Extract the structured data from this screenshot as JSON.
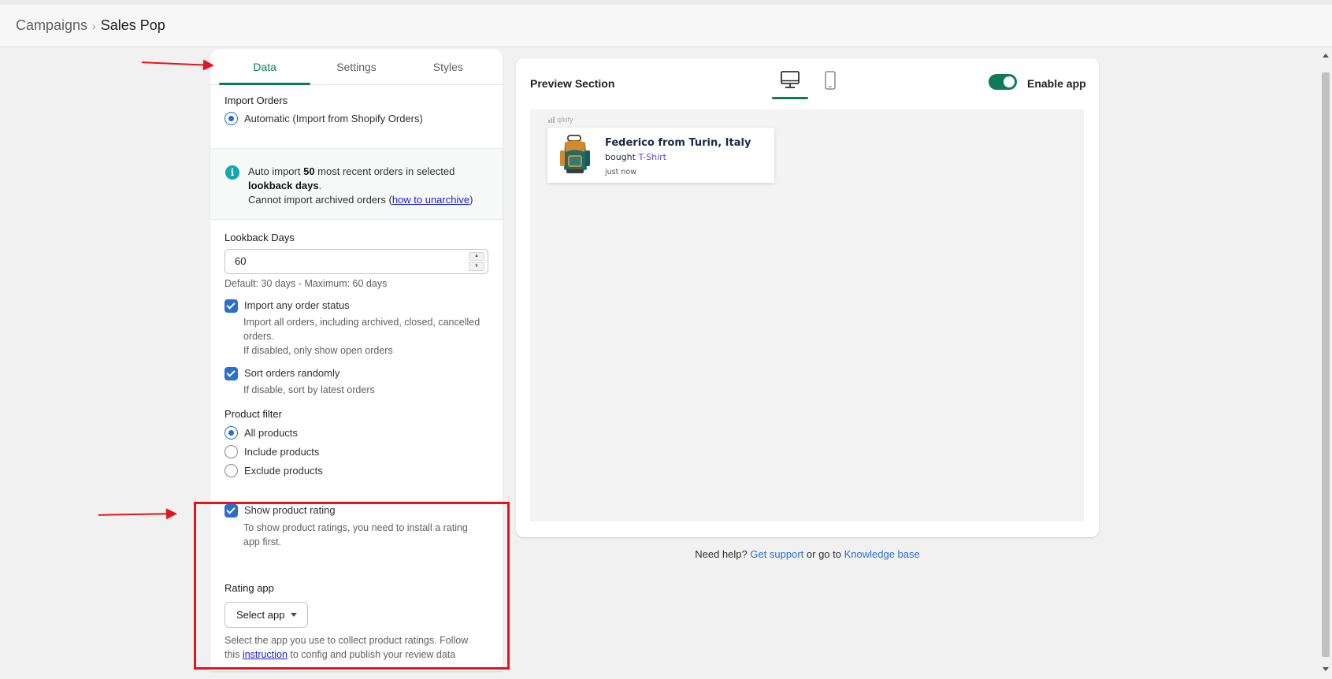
{
  "breadcrumb": {
    "parent": "Campaigns",
    "separator": "›",
    "current": "Sales Pop"
  },
  "tabs": [
    {
      "label": "Data",
      "active": true
    },
    {
      "label": "Settings",
      "active": false
    },
    {
      "label": "Styles",
      "active": false
    }
  ],
  "import_orders": {
    "label": "Import Orders",
    "option": "Automatic (Import from Shopify Orders)"
  },
  "info": {
    "line1_pre": "Auto import ",
    "count": "50",
    "line1_post": " most recent orders in selected",
    "line2_bold": "lookback days",
    "line2_post": ".",
    "line3_pre": "Cannot import archived orders (",
    "line3_link": "how to unarchive",
    "line3_post": ")"
  },
  "lookback": {
    "label": "Lookback Days",
    "value": "60",
    "help": "Default: 30 days - Maximum: 60 days"
  },
  "import_any_status": {
    "label": "Import any order status",
    "help1": "Import all orders, including archived, closed, cancelled",
    "help2": "orders.",
    "help3": "If disabled, only show open orders",
    "checked": true
  },
  "sort_random": {
    "label": "Sort orders randomly",
    "help": "If disable, sort by latest orders",
    "checked": true
  },
  "product_filter": {
    "label": "Product filter",
    "options": [
      {
        "label": "All products",
        "selected": true
      },
      {
        "label": "Include products",
        "selected": false
      },
      {
        "label": "Exclude products",
        "selected": false
      }
    ]
  },
  "show_rating": {
    "label": "Show product rating",
    "help1": "To show product ratings, you need to install a rating",
    "help2": "app first.",
    "checked": true
  },
  "rating_app": {
    "label": "Rating app",
    "select_value": "Select app",
    "help1": "Select the app you use to collect product ratings. Follow",
    "help2_pre": "this ",
    "help2_link": "instruction",
    "help2_post": " to config and publish your review data"
  },
  "preview": {
    "title": "Preview Section",
    "device_icons": [
      "desktop-icon",
      "mobile-icon"
    ],
    "enable_label": "Enable app",
    "enabled": true,
    "brand": "qikify",
    "popup": {
      "name": "Federico from Turin, Italy",
      "bought": "bought ",
      "product": "T-Shirt",
      "time": "just now"
    }
  },
  "footer": {
    "pre": "Need help? ",
    "support": "Get support",
    "mid": " or go to ",
    "kb": "Knowledge base"
  },
  "colors": {
    "accent": "#0f7a58",
    "link": "#2c6ecb",
    "annotation": "#e3141b"
  }
}
